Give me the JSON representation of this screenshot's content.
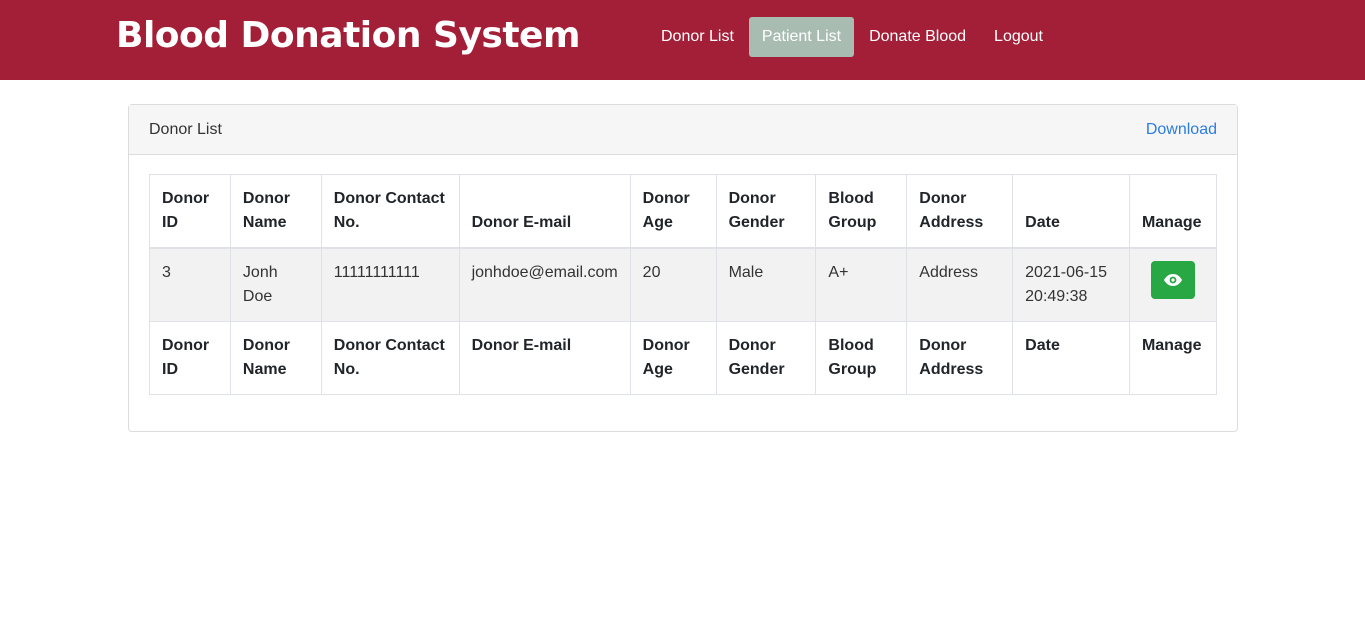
{
  "navbar": {
    "brand": "Blood Donation System",
    "links": [
      {
        "label": "Donor List"
      },
      {
        "label": "Patient List",
        "active": true
      },
      {
        "label": "Donate Blood"
      },
      {
        "label": "Logout"
      }
    ]
  },
  "card": {
    "title": "Donor List",
    "download_label": "Download"
  },
  "table": {
    "headers": [
      "Donor ID",
      "Donor Name",
      "Donor Contact No.",
      "Donor E-mail",
      "Donor Age",
      "Donor Gender",
      "Blood Group",
      "Donor Address",
      "Date",
      "Manage"
    ],
    "rows": [
      {
        "id": "3",
        "name": "Jonh Doe",
        "contact": "11111111111",
        "email": "jonhdoe@email.com",
        "age": "20",
        "gender": "Male",
        "blood_group": "A+",
        "address": "Address",
        "date": "2021-06-15 20:49:38",
        "manage_icon": "eye-icon"
      }
    ]
  },
  "colors": {
    "navbar": "#a31f37",
    "active_nav": "#a9bcb2",
    "view_button": "#28a745",
    "link": "#2b7de0"
  }
}
